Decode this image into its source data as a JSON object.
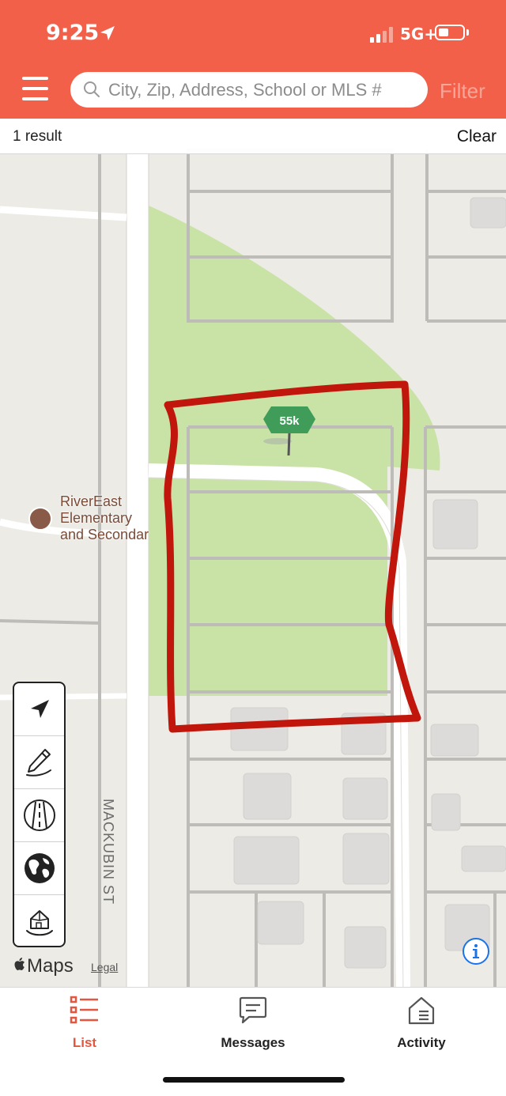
{
  "status_bar": {
    "time": "9:25",
    "network": "5G+"
  },
  "search": {
    "placeholder": "City, Zip, Address, School or MLS #",
    "filter_label": "Filter"
  },
  "results": {
    "count_label": "1 result",
    "clear_label": "Clear"
  },
  "map": {
    "price_pin": "55k",
    "school_label_lines": [
      "RiverEast",
      "Elementary",
      "and Secondar"
    ],
    "street_label": "MACKUBIN ST",
    "controls": [
      "location-arrow-icon",
      "draw-pencil-icon",
      "road-icon",
      "globe-icon",
      "house-3d-icon"
    ],
    "attribution_brand": "Maps",
    "legal_link": "Legal"
  },
  "tabs": [
    {
      "label": "List",
      "icon": "list-icon",
      "active": true
    },
    {
      "label": "Messages",
      "icon": "chat-bubble-icon",
      "active": false
    },
    {
      "label": "Activity",
      "icon": "house-activity-icon",
      "active": false
    }
  ],
  "colors": {
    "brand": "#f2604a",
    "filter_text": "#f7a597",
    "park_green": "#c9e3a7",
    "pin_green": "#3f9d59",
    "draw_stroke": "#c0160c",
    "active_tab": "#e4563f"
  }
}
